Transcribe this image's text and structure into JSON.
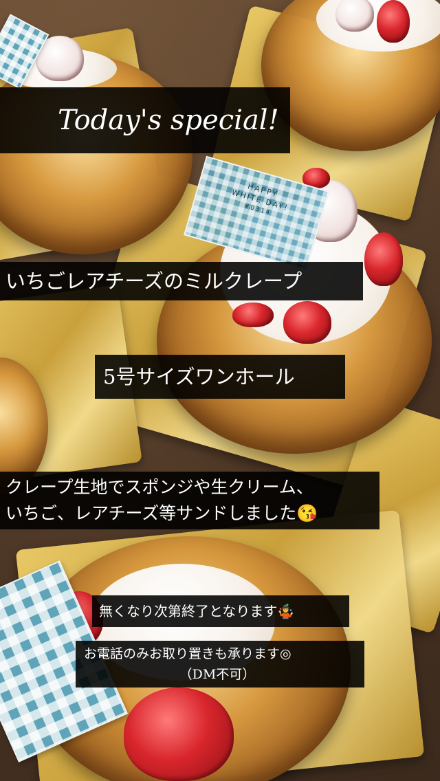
{
  "photo": {
    "subject": "",
    "flag_text_line1": "HAPPY",
    "flag_text_line2": "WHITE DAY!",
    "flag_text_line3": "#0314"
  },
  "captions": {
    "title": "Today's special!",
    "product_name": "いちごレアチーズのミルクレープ",
    "size": "5号サイズワンホール",
    "description_line1": "クレープ生地でスポンジや生クリーム、",
    "description_line2": "いちご、レアチーズ等サンドしました😘",
    "sold_out_notice": "無くなり次第終了となります🤹",
    "reservation_line1": "お電話のみお取り置きも承ります◎",
    "reservation_line2": "（DM不可）"
  },
  "colors": {
    "caption_background": "#000000",
    "caption_text": "#ffffff",
    "gold_board": "#c9a03c",
    "gingham_blue": "#5fa4b8",
    "strawberry_red": "#d8262c"
  }
}
